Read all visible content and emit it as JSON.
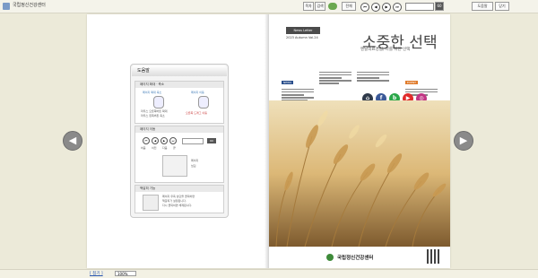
{
  "window": {
    "title": "국립정신건강센터"
  },
  "toolbar": {
    "btn_a": "목차",
    "btn_b": "검색",
    "btn_c": "전체",
    "nav_first": "⏮",
    "nav_prev": "◀",
    "nav_next": "▶",
    "nav_last": "⏭",
    "page_total": "60",
    "btn_right1": "도움말",
    "btn_right2": "닫기"
  },
  "help": {
    "title": "도움말",
    "sec1": {
      "title": "페이지 확대 · 축소",
      "left_label": "페이지 확대 축소",
      "right_label": "페이지 이동",
      "left_desc1": "마우스 오른쪽버튼 확대",
      "left_desc2": "마우스 왼쪽버튼 축소",
      "right_desc": "오른쪽 드래그 이동"
    },
    "sec2": {
      "title": "페이지 이동",
      "labels": [
        "처음",
        "이전",
        "다음",
        "끝"
      ],
      "page_total": "60",
      "desc1": "페이지",
      "desc2": "넘김"
    },
    "sec3": {
      "title": "책갈피 기능",
      "desc1": "페이지 우측 상단을 클릭하면",
      "desc2": "책갈피가 설정됩니다.",
      "desc3": "다시 클릭하면 해제됩니다."
    }
  },
  "cover": {
    "newsletter_tag": "News Letter",
    "issue": "2023 Autumn Vol.24",
    "title": "소중한 선택",
    "subtitle": "멘탈의료경험, 나를 위한 선택",
    "col_tags": [
      "NEWS",
      "",
      "",
      "EVENT"
    ],
    "footer_org": "국립정신건강센터"
  },
  "social": {
    "icons": [
      "home-icon",
      "facebook-icon",
      "blog-icon",
      "youtube-icon",
      "instagram-icon"
    ]
  },
  "statusbar": {
    "link_label": "[ 접기 ]",
    "zoom": "100%"
  },
  "colors": {
    "accent_blue": "#3c79b6",
    "accent_red": "#c83b3b",
    "tag_blue": "#2a4f8c",
    "tag_orange": "#e07b2b"
  }
}
